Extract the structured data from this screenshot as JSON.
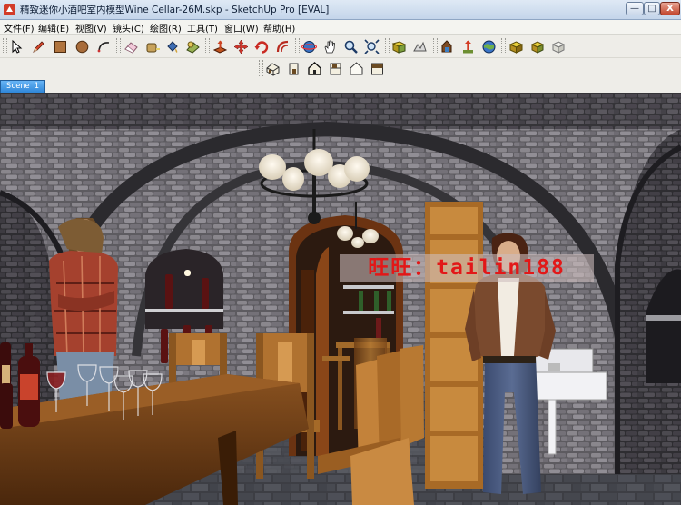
{
  "window": {
    "title": "精致迷你小酒吧室内模型Wine Cellar-26M.skp - SketchUp Pro [EVAL]",
    "controls": {
      "minimize": "—",
      "maximize": "□",
      "close": "X"
    }
  },
  "menu": [
    "文件(F)",
    "编辑(E)",
    "视图(V)",
    "镜头(C)",
    "绘图(R)",
    "工具(T)",
    "窗口(W)",
    "帮助(H)"
  ],
  "toolbar_main": [
    "select-icon",
    "pencil-icon",
    "rectangle-icon",
    "circle-icon",
    "arc-icon",
    "eraser-icon",
    "tape-measure-icon",
    "paint-bucket-icon",
    "push-pull-icon",
    "move-icon",
    "rotate-icon",
    "offset-icon",
    "orbit-icon",
    "pan-icon",
    "zoom-icon",
    "zoom-extents-icon",
    "add-location-icon",
    "terrain-icon",
    "warehouse-icon",
    "share-model-icon",
    "google-earth-icon",
    "component-icon",
    "get-models-icon",
    "share-component-icon"
  ],
  "toolbar_views": [
    "iso-view-icon",
    "front-view-icon",
    "top-view-icon",
    "right-view-icon",
    "back-view-icon",
    "left-view-icon"
  ],
  "scene_tabs": [
    "Scene 1"
  ],
  "viewport": {
    "watermark": "旺旺：tailin188"
  }
}
